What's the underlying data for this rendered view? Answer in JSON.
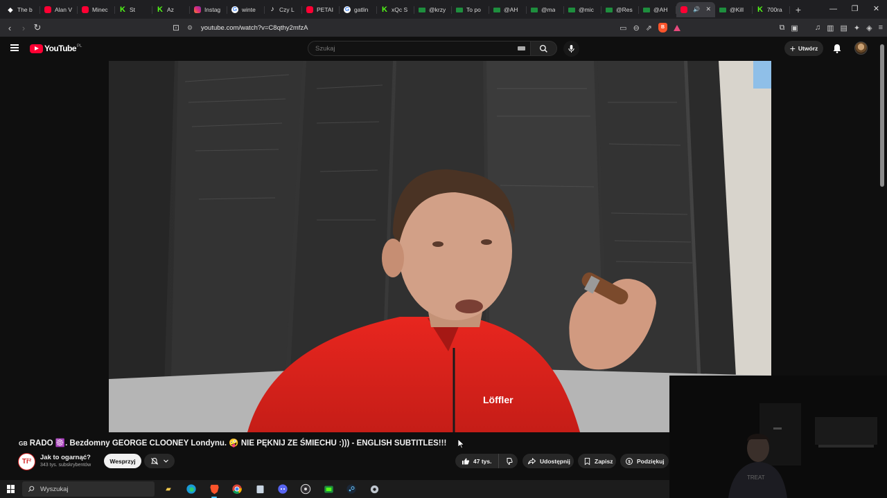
{
  "browser": {
    "tabs": [
      {
        "label": "The b",
        "icon": "brave-icon"
      },
      {
        "label": "Alan V",
        "icon": "youtube-icon"
      },
      {
        "label": "Minec",
        "icon": "youtube-icon"
      },
      {
        "label": "St",
        "icon": "kick-icon"
      },
      {
        "label": "Az",
        "icon": "kick-icon"
      },
      {
        "label": "Instag",
        "icon": "instagram-icon"
      },
      {
        "label": "winte",
        "icon": "google-icon"
      },
      {
        "label": "Czy L",
        "icon": "tiktok-icon"
      },
      {
        "label": "PETAI",
        "icon": "youtube-icon"
      },
      {
        "label": "gatlin",
        "icon": "google-icon"
      },
      {
        "label": "xQc S",
        "icon": "kick-icon"
      },
      {
        "label": "@krzy",
        "icon": "camera-icon"
      },
      {
        "label": "To po",
        "icon": "camera-icon"
      },
      {
        "label": "@AH",
        "icon": "camera-icon"
      },
      {
        "label": "@ma",
        "icon": "camera-icon"
      },
      {
        "label": "@mic",
        "icon": "camera-icon"
      },
      {
        "label": "@Res",
        "icon": "camera-icon"
      },
      {
        "label": "@AH",
        "icon": "camera-icon"
      },
      {
        "label": "",
        "icon": "youtube-icon",
        "active": true
      },
      {
        "label": "@Kill",
        "icon": "camera-icon"
      },
      {
        "label": "700ra",
        "icon": "kick-icon"
      }
    ],
    "url": "youtube.com/watch?v=C8qthy2mfzA"
  },
  "youtube": {
    "logo_text": "YouTube",
    "region": "PL",
    "search_placeholder": "Szukaj",
    "create_label": "Utwórz"
  },
  "video": {
    "title_flag": "GB",
    "title": "RADO ☸️. Bezdomny GEORGE CLOONEY Londynu. 🤪 NIE PĘKNIJ ZE ŚMIECHU :))) - ENGLISH SUBTITLES!!!",
    "channel_name": "Jak to ogarnąć?",
    "channel_avatar_text": "Tř²",
    "subscribers": "343 tys. subskrybentów",
    "support_label": "Wesprzyj",
    "likes": "47 tys.",
    "share_label": "Udostępnij",
    "save_label": "Zapisz",
    "thanks_label": "Podziękuj"
  },
  "taskbar": {
    "search_placeholder": "Wyszukaj"
  },
  "colors": {
    "youtube_red": "#ff0033",
    "background": "#0f0f0f",
    "pill": "#272727"
  }
}
